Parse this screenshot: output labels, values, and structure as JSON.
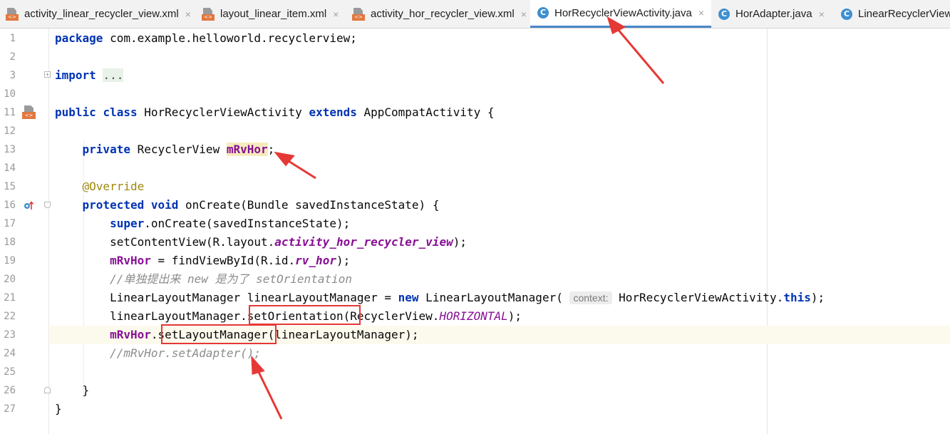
{
  "tabs": [
    {
      "label": "activity_linear_recycler_view.xml",
      "icon": "xml-file-icon",
      "active": false
    },
    {
      "label": "layout_linear_item.xml",
      "icon": "xml-file-icon",
      "active": false
    },
    {
      "label": "activity_hor_recycler_view.xml",
      "icon": "xml-file-icon",
      "active": false
    },
    {
      "label": "HorRecyclerViewActivity.java",
      "icon": "java-class-icon",
      "active": true
    },
    {
      "label": "HorAdapter.java",
      "icon": "java-class-icon",
      "active": false
    },
    {
      "label": "LinearRecyclerView.",
      "icon": "java-class-icon",
      "active": false
    }
  ],
  "close_glyph": "×",
  "class_icon_letter": "C",
  "xml_badge": "<>",
  "fold_collapsed_glyph": "+",
  "fold_open_glyph": "−",
  "line_numbers": [
    "1",
    "2",
    "3",
    "10",
    "11",
    "12",
    "13",
    "14",
    "15",
    "16",
    "17",
    "18",
    "19",
    "20",
    "21",
    "22",
    "23",
    "24",
    "25",
    "26",
    "27"
  ],
  "code": {
    "l1": {
      "kw": "package",
      "rest": " com.example.helloworld.recyclerview;"
    },
    "l3": {
      "kw": "import",
      "sp": " ",
      "folded": "..."
    },
    "l11": {
      "kw1": "public",
      "sp1": " ",
      "kw2": "class",
      "mid": " HorRecyclerViewActivity ",
      "kw3": "extends",
      "rest": " AppCompatActivity {"
    },
    "l13": {
      "indent": "    ",
      "kw": "private",
      "mid": " RecyclerView ",
      "field": "mRvHor",
      "rest": ";"
    },
    "l15": {
      "indent": "    ",
      "ann": "@Override"
    },
    "l16": {
      "indent": "    ",
      "kw1": "protected",
      "sp": " ",
      "kw2": "void",
      "rest": " onCreate(Bundle savedInstanceState) {"
    },
    "l17": {
      "indent": "        ",
      "kw": "super",
      "rest": ".onCreate(savedInstanceState);"
    },
    "l18": {
      "indent": "        ",
      "pre": "setContentView(R.layout.",
      "ital": "activity_hor_recycler_view",
      "rest": ");"
    },
    "l19": {
      "indent": "        ",
      "field": "mRvHor",
      "mid": " = findViewById(R.id.",
      "ital": "rv_hor",
      "rest": ");"
    },
    "l20": {
      "indent": "        ",
      "comment": "//单独提出来 new 是为了 setOrientation"
    },
    "l21": {
      "indent": "        ",
      "pre": "LinearLayoutManager linearLayoutManager = ",
      "kw": "new",
      "mid": " LinearLayoutManager( ",
      "hint": "context:",
      "mid2": " HorRecyclerViewActivity.",
      "kw2": "this",
      "rest": ");"
    },
    "l22": {
      "indent": "        ",
      "pre": "linearLayoutManager.setOrientation(RecyclerView.",
      "ital": "HORIZONTAL",
      "rest": ");"
    },
    "l23": {
      "indent": "        ",
      "field": "mRvHor",
      "rest": ".setLayoutManager(linearLayoutManager);"
    },
    "l24": {
      "indent": "        ",
      "comment": "//mRvHor.setAdapter();"
    },
    "l26": {
      "indent": "    ",
      "text": "}"
    },
    "l27": {
      "text": "}"
    }
  },
  "colors": {
    "keyword": "#0033b3",
    "field": "#871094",
    "annotation": "#9e880d",
    "comment": "#8c8c8c",
    "annotation_red": "#e53935",
    "active_tab_underline": "#4a86c8"
  }
}
